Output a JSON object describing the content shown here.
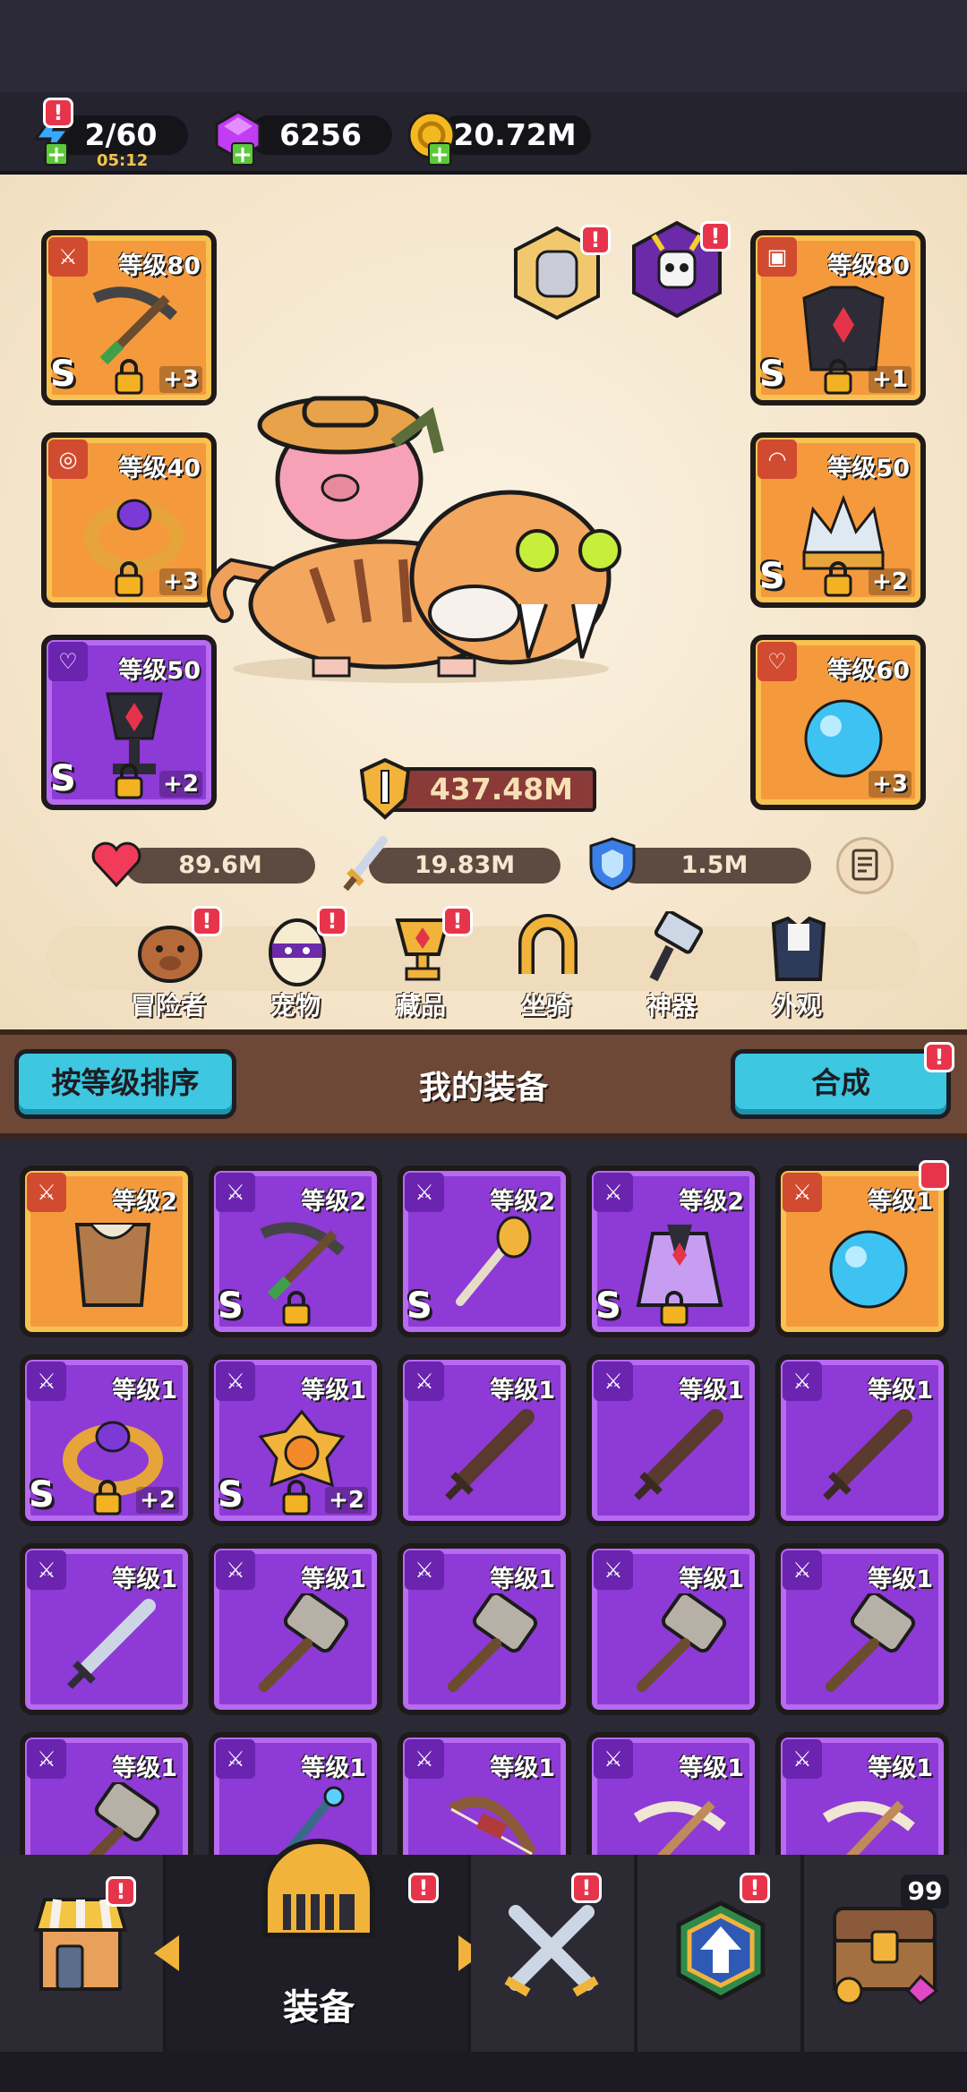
{
  "resources": {
    "energy": {
      "value": "2/60",
      "timer": "05:12"
    },
    "gems": {
      "value": "6256"
    },
    "coins": {
      "value": "20.72M"
    }
  },
  "hero": {
    "power": "437.48M",
    "stats": {
      "hp": "89.6M",
      "attack": "19.83M",
      "defense": "1.5M"
    },
    "left_slots": [
      {
        "level": "等级80",
        "grade": "S",
        "plus": "+3",
        "icon": "crossbow-icon",
        "frame": "orange"
      },
      {
        "level": "等级40",
        "grade": "",
        "plus": "+3",
        "icon": "ring-icon",
        "frame": "orange"
      },
      {
        "level": "等级50",
        "grade": "S",
        "plus": "+2",
        "icon": "chalice-icon",
        "frame": "purple"
      }
    ],
    "right_slots": [
      {
        "level": "等级80",
        "grade": "S",
        "plus": "+1",
        "icon": "armor-icon",
        "frame": "orange"
      },
      {
        "level": "等级50",
        "grade": "S",
        "plus": "+2",
        "icon": "crown-icon",
        "frame": "orange"
      },
      {
        "level": "等级60",
        "grade": "",
        "plus": "+3",
        "icon": "potion-icon",
        "frame": "orange"
      }
    ],
    "categories": [
      {
        "label": "冒险者",
        "icon": "capybara-icon"
      },
      {
        "label": "宠物",
        "icon": "egg-icon"
      },
      {
        "label": "藏品",
        "icon": "trophy-icon"
      },
      {
        "label": "坐骑",
        "icon": "horseshoe-icon"
      },
      {
        "label": "神器",
        "icon": "hammer-icon"
      },
      {
        "label": "外观",
        "icon": "outfit-icon"
      }
    ]
  },
  "equipment_bar": {
    "sort_label": "按等级排序",
    "title": "我的装备",
    "merge_label": "合成"
  },
  "inventory": [
    {
      "level": "等级2",
      "grade": "",
      "plus": "",
      "frame": "orange",
      "icon": "cape-icon",
      "lock": false
    },
    {
      "level": "等级2",
      "grade": "S",
      "plus": "",
      "frame": "purple",
      "icon": "crossbow-icon",
      "lock": true
    },
    {
      "level": "等级2",
      "grade": "S",
      "plus": "",
      "frame": "purple",
      "icon": "torch-icon",
      "lock": false
    },
    {
      "level": "等级2",
      "grade": "S",
      "plus": "",
      "frame": "purple",
      "icon": "cloak-icon",
      "lock": true
    },
    {
      "level": "等级1",
      "grade": "",
      "plus": "",
      "frame": "orange",
      "icon": "potion-icon",
      "lock": false
    },
    {
      "level": "等级1",
      "grade": "S",
      "plus": "+2",
      "frame": "purple",
      "icon": "ring-icon",
      "lock": true
    },
    {
      "level": "等级1",
      "grade": "S",
      "plus": "+2",
      "frame": "purple",
      "icon": "medal-icon",
      "lock": true
    },
    {
      "level": "等级1",
      "grade": "",
      "plus": "",
      "frame": "purple",
      "icon": "sword-icon",
      "lock": false
    },
    {
      "level": "等级1",
      "grade": "",
      "plus": "",
      "frame": "purple",
      "icon": "sword-icon",
      "lock": false
    },
    {
      "level": "等级1",
      "grade": "",
      "plus": "",
      "frame": "purple",
      "icon": "sword-icon",
      "lock": false
    },
    {
      "level": "等级1",
      "grade": "",
      "plus": "",
      "frame": "purple",
      "icon": "steel-sword-icon",
      "lock": false
    },
    {
      "level": "等级1",
      "grade": "",
      "plus": "",
      "frame": "purple",
      "icon": "hammer-icon",
      "lock": false
    },
    {
      "level": "等级1",
      "grade": "",
      "plus": "",
      "frame": "purple",
      "icon": "hammer-icon",
      "lock": false
    },
    {
      "level": "等级1",
      "grade": "",
      "plus": "",
      "frame": "purple",
      "icon": "hammer-icon",
      "lock": false
    },
    {
      "level": "等级1",
      "grade": "",
      "plus": "",
      "frame": "purple",
      "icon": "hammer-icon",
      "lock": false
    },
    {
      "level": "等级1",
      "grade": "",
      "plus": "",
      "frame": "purple",
      "icon": "hammer-icon",
      "lock": false
    },
    {
      "level": "等级1",
      "grade": "",
      "plus": "",
      "frame": "purple",
      "icon": "staff-icon",
      "lock": false
    },
    {
      "level": "等级1",
      "grade": "",
      "plus": "",
      "frame": "purple",
      "icon": "bow-icon",
      "lock": false
    },
    {
      "level": "等级1",
      "grade": "",
      "plus": "",
      "frame": "purple",
      "icon": "bone-crossbow-icon",
      "lock": false
    },
    {
      "level": "等级1",
      "grade": "",
      "plus": "",
      "frame": "purple",
      "icon": "bone-crossbow-icon",
      "lock": false
    }
  ],
  "bottom_nav": {
    "active_label": "装备",
    "chest_count": "99"
  },
  "badge_text": "!",
  "colors": {
    "accent_blue": "#3dc7e0",
    "badge_red": "#e8344a",
    "orange_frame": "#f49a3c",
    "purple_frame": "#8e3ad6"
  }
}
